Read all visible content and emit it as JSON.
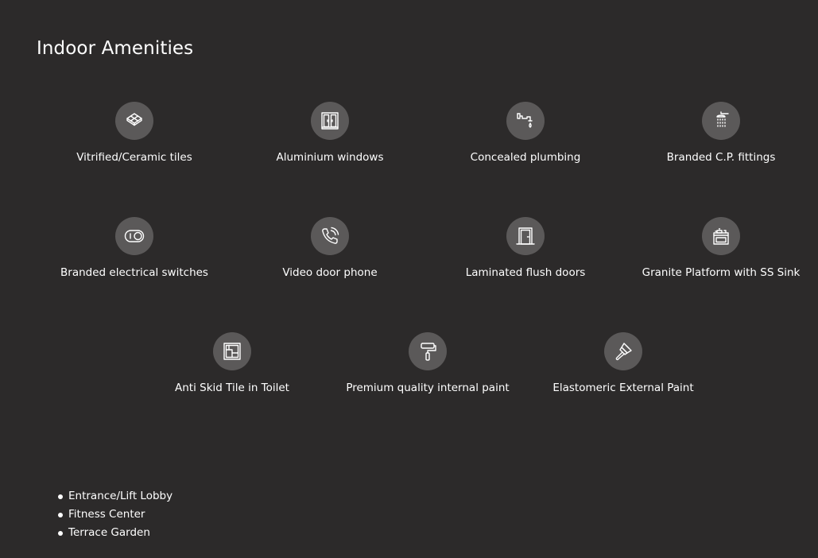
{
  "section": {
    "title": "Indoor Amenities"
  },
  "amenities": [
    {
      "label": "Vitrified/Ceramic tiles",
      "icon": "tiles-icon"
    },
    {
      "label": "Aluminium windows",
      "icon": "window-icon"
    },
    {
      "label": "Concealed plumbing",
      "icon": "pipe-faucet-icon"
    },
    {
      "label": "Branded C.P. fittings",
      "icon": "shower-icon"
    },
    {
      "label": "Branded electrical switches",
      "icon": "switch-icon"
    },
    {
      "label": "Video door phone",
      "icon": "phone-icon"
    },
    {
      "label": "Laminated flush doors",
      "icon": "door-icon"
    },
    {
      "label": "Granite Platform with SS Sink",
      "icon": "stove-sink-icon"
    },
    {
      "label": "Anti Skid Tile in Toilet",
      "icon": "floor-tile-icon"
    },
    {
      "label": "Premium quality internal paint",
      "icon": "paint-roller-icon"
    },
    {
      "label": "Elastomeric External Paint",
      "icon": "paint-brush-icon"
    }
  ],
  "other_amenities": [
    "Entrance/Lift Lobby",
    "Fitness Center",
    "Terrace Garden"
  ],
  "colors": {
    "background": "#2c2a2a",
    "icon_circle": "#5b5959",
    "text": "#ffffff"
  }
}
